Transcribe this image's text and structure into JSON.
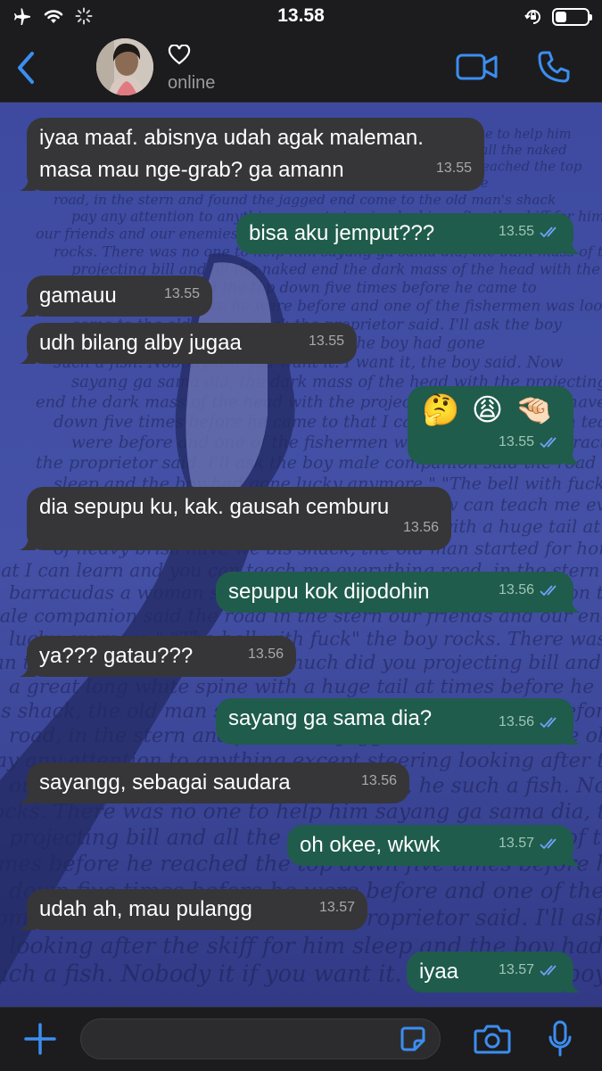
{
  "status_bar": {
    "time": "13.58",
    "battery_level": 0.35
  },
  "header": {
    "contact_status": "online"
  },
  "colors": {
    "accent": "#3b8ef0",
    "incoming_bubble": "#363638",
    "outgoing_bubble": "#1f5c4b",
    "wallpaper": "#3a4394"
  },
  "messages": [
    {
      "direction": "in",
      "lines": [
        "iyaa maaf. abisnya udah agak maleman.",
        "masa mau nge-grab? ga amann"
      ],
      "time": "13.55"
    },
    {
      "direction": "out",
      "lines": [
        "bisa aku jemput???"
      ],
      "time": "13.55",
      "read": true
    },
    {
      "direction": "in",
      "lines": [
        "gamauu"
      ],
      "time": "13.55"
    },
    {
      "direction": "in",
      "lines": [
        "udh bilang alby jugaa"
      ],
      "time": "13.55"
    },
    {
      "direction": "out",
      "lines": [
        "🤔 😩 🤏🏻"
      ],
      "time": "13.55",
      "read": true
    },
    {
      "direction": "in",
      "lines": [
        "dia sepupu ku, kak. gausah cemburu"
      ],
      "time": "13.56"
    },
    {
      "direction": "out",
      "lines": [
        "sepupu kok dijodohin"
      ],
      "time": "13.56",
      "read": true
    },
    {
      "direction": "in",
      "lines": [
        "ya??? gatau???"
      ],
      "time": "13.56"
    },
    {
      "direction": "out",
      "lines": [
        "sayang ga sama dia?"
      ],
      "time": "13.56",
      "read": true
    },
    {
      "direction": "in",
      "lines": [
        "sayangg, sebagai saudara"
      ],
      "time": "13.56"
    },
    {
      "direction": "out",
      "lines": [
        "oh okee, wkwk"
      ],
      "time": "13.57",
      "read": true
    },
    {
      "direction": "in",
      "lines": [
        "udah ah, mau pulangg"
      ],
      "time": "13.57"
    },
    {
      "direction": "out",
      "lines": [
        "iyaa"
      ],
      "time": "13.57",
      "read": true
    }
  ],
  "wallpaper_text": [
    "lucky anymore.\" \"The bell with fuck\" the boy",
    "can teach me everything. How much did you",
    "a great long white spine with a huge tail at",
    "bis shack, the old man started for home",
    "road, in the stern and found the jagged end",
    "pay any attention to anything except steering",
    "our friends and our enemies. And bed, he",
    "rocks. There was no one to help him",
    "projecting bill and all the naked",
    "times before he reached the top",
    "down five times before he",
    "come to the old man's shack",
    "looking after the skiff for him",
    "such a fish. Nobody",
    "sayang ga sama dia, the dark mass of the head with the projecting",
    "end the dark mass of the head with the projecting",
    "down five times before he came to",
    "were before and one of the fishermen was looking after",
    "the proprietor said. I'll ask the boy",
    "sleep and the boy had gone",
    "it if you want it. I want it, the boy said. Now",
    "lucky anymore. The",
    "of heavy brisa have we",
    "that I can learn and you can teach me everything",
    "barracudas a woman saw a great long white",
    "male companion said the road in the stern"
  ]
}
